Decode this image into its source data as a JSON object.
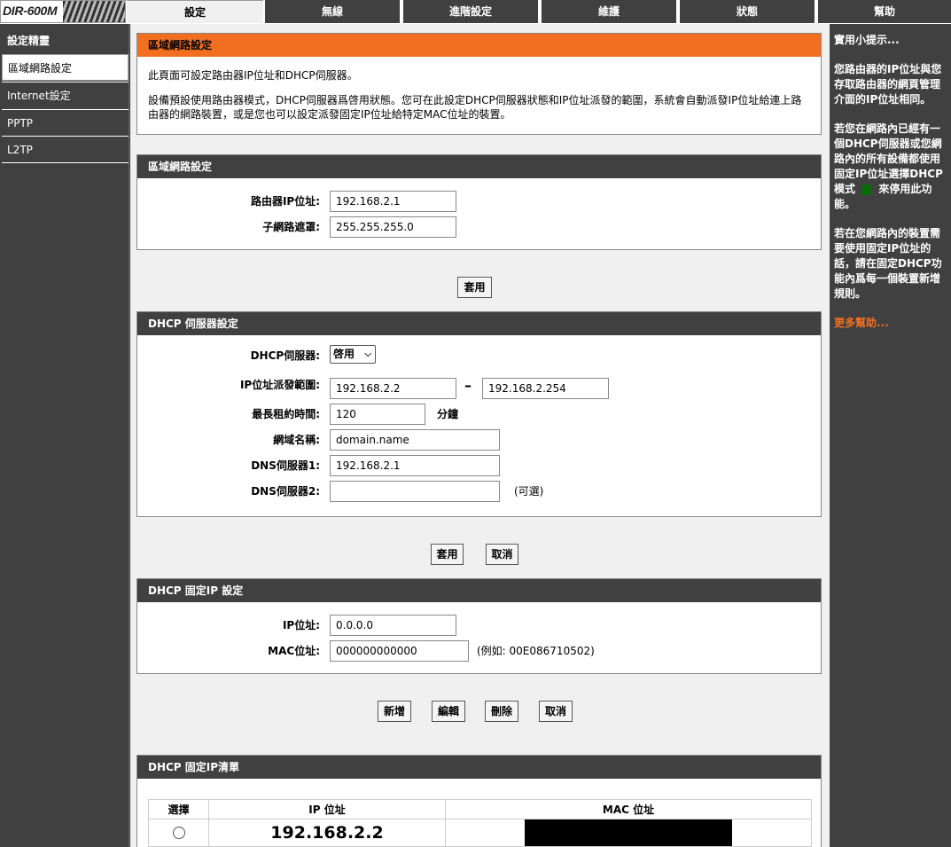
{
  "logo": {
    "text": "DIR-600M"
  },
  "tabs": [
    {
      "label": "設定"
    },
    {
      "label": "無線"
    },
    {
      "label": "進階設定"
    },
    {
      "label": "維護"
    },
    {
      "label": "狀態"
    },
    {
      "label": "幫助"
    }
  ],
  "sidebar": {
    "title": "設定精靈",
    "items": [
      {
        "label": "區域網路設定"
      },
      {
        "label": "Internet設定"
      },
      {
        "label": "PPTP"
      },
      {
        "label": "L2TP"
      }
    ]
  },
  "intro": {
    "title": "區域網路設定",
    "line1": "此頁面可設定路由器IP位址和DHCP伺服器。",
    "line2": "設備預設使用路由器模式，DHCP伺服器爲啓用狀態。您可在此設定DHCP伺服器狀態和IP位址派發的範圍，系統會自動派發IP位址給連上路由器的網路裝置，或是您也可以設定派發固定IP位址給特定MAC位址的裝置。"
  },
  "lan": {
    "title": "區域網路設定",
    "ip_label": "路由器IP位址:",
    "ip_value": "192.168.2.1",
    "mask_label": "子網路遮罩:",
    "mask_value": "255.255.255.0",
    "apply": "套用"
  },
  "dhcp": {
    "title": "DHCP 伺服器設定",
    "server_label": "DHCP伺服器:",
    "server_value": "啓用",
    "range_label": "IP位址派發範圍:",
    "range_start": "192.168.2.2",
    "range_sep": "–",
    "range_end": "192.168.2.254",
    "lease_label": "最長租約時間:",
    "lease_value": "120",
    "lease_unit": "分鐘",
    "domain_label": "網域名稱:",
    "domain_value": "domain.name",
    "dns1_label": "DNS伺服器1:",
    "dns1_value": "192.168.2.1",
    "dns2_label": "DNS伺服器2:",
    "dns2_value": "",
    "dns2_optional": "(可選)",
    "apply": "套用",
    "cancel": "取消"
  },
  "static": {
    "title": "DHCP 固定IP 設定",
    "ip_label": "IP位址:",
    "ip_value": "0.0.0.0",
    "mac_label": "MAC位址:",
    "mac_value": "000000000000",
    "mac_example": "(例如: 00E086710502)",
    "add": "新增",
    "edit": "編輯",
    "delete": "刪除",
    "cancel": "取消"
  },
  "list": {
    "title": "DHCP 固定IP清單",
    "columns": [
      "選擇",
      "IP 位址",
      "MAC 位址"
    ],
    "rows": [
      {
        "ip": "192.168.2.2",
        "mac": ""
      }
    ]
  },
  "help": {
    "title": "實用小提示...",
    "p1": "您路由器的IP位址與您存取路由器的網頁管理介面的IP位址相同。",
    "p2a": "若您在網路內已經有一個DHCP伺服器或您網路內的所有設備都使用固定IP位址選擇DHCP模式",
    "p2b": "來停用此功能。",
    "p3": "若在您網路內的裝置需要使用固定IP位址的話，請在固定DHCP功能內爲每一個裝置新增規則。",
    "more": "更多幫助..."
  },
  "colors": {
    "accent": "#f26f22",
    "dark": "#404040"
  }
}
